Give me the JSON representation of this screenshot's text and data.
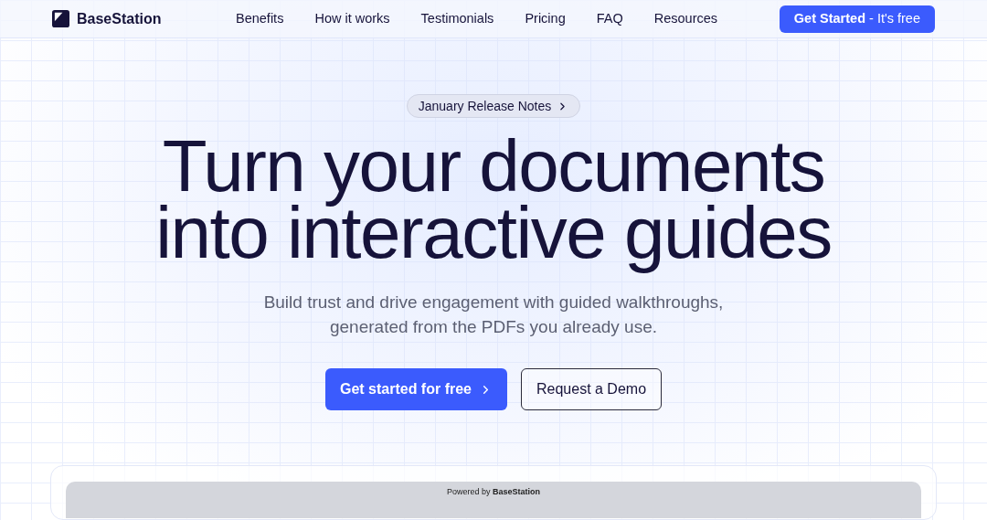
{
  "header": {
    "brand": "BaseStation",
    "nav": [
      "Benefits",
      "How it works",
      "Testimonials",
      "Pricing",
      "FAQ",
      "Resources"
    ],
    "cta": "**Get Started** - It's free"
  },
  "hero": {
    "badge": "January Release Notes",
    "title_lines": [
      "Turn your documents",
      "into interactive guides"
    ],
    "subtitle_lines": [
      "Build trust and drive engagement with guided walkthroughs,",
      "generated from the PDFs you already use."
    ],
    "primary_button": "Get started for free",
    "secondary_button": "Request a Demo"
  },
  "preview": {
    "caption": "Powered by **BaseStation**"
  }
}
